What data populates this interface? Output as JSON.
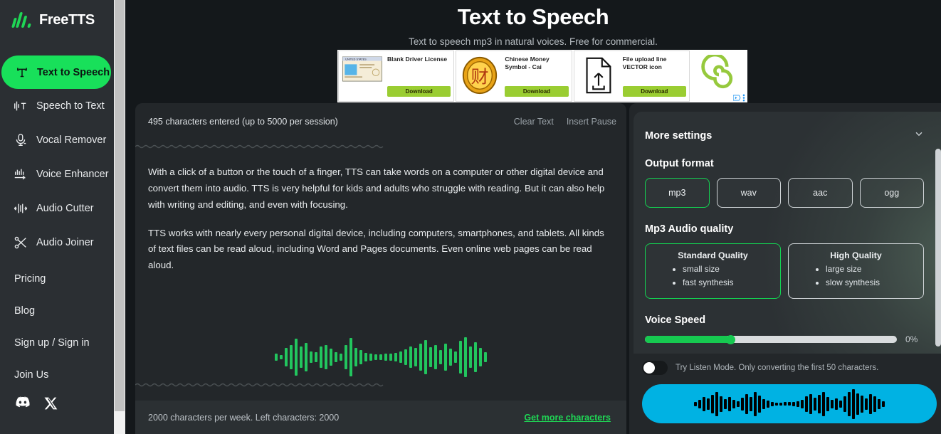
{
  "sidebar": {
    "brand": "FreeTTS",
    "brand_accent": "#1fd655",
    "items": [
      {
        "label": "Text to Speech",
        "icon": "text-to-speech-icon",
        "active": true
      },
      {
        "label": "Speech to Text",
        "icon": "speech-to-text-icon",
        "active": false
      },
      {
        "label": "Vocal Remover",
        "icon": "microphone-icon",
        "active": false
      },
      {
        "label": "Voice Enhancer",
        "icon": "voice-enhancer-icon",
        "active": false
      },
      {
        "label": "Audio Cutter",
        "icon": "audio-cutter-icon",
        "active": false
      },
      {
        "label": "Audio Joiner",
        "icon": "scissors-icon",
        "active": false
      }
    ],
    "links": [
      {
        "label": "Pricing"
      },
      {
        "label": "Blog"
      },
      {
        "label": "Sign up / Sign in"
      },
      {
        "label": "Join Us"
      }
    ],
    "socials": [
      {
        "name": "discord-icon"
      },
      {
        "name": "x-twitter-icon"
      }
    ]
  },
  "header": {
    "title": "Text to Speech",
    "subtitle": "Text to speech mp3 in natural voices. Free for commercial."
  },
  "ad": {
    "cards": [
      {
        "title": "Blank Driver License",
        "button": "Download",
        "thumb": "id-card-thumb"
      },
      {
        "title": "Chinese Money Symbol - Cai",
        "button": "Download",
        "thumb": "chinese-coin-thumb"
      },
      {
        "title": "File upload line VECTOR icon",
        "button": "Download",
        "thumb": "file-upload-thumb"
      }
    ],
    "brand_logo": "green-spiral-logo",
    "adchoices": "adchoices-icon"
  },
  "editor": {
    "char_count": "495 characters entered (up to 5000 per session)",
    "clear_text": "Clear Text",
    "insert_pause": "Insert Pause",
    "paragraphs": [
      "With a click of a button or the touch of a finger, TTS can take words on a computer or other digital device and convert them into audio. TTS is very helpful for kids and adults who struggle with reading. But it can also help with writing and editing, and even with focusing.",
      "TTS works with nearly every personal digital device, including computers, smartphones, and tablets. All kinds of text files can be read aloud, including Word and Pages documents. Even online web pages can be read aloud."
    ],
    "footer_text": "2000 characters per week. Left characters: 2000",
    "footer_link": "Get more characters",
    "waveform_color": "#22c55e"
  },
  "settings": {
    "title": "More settings",
    "collapse_icon": "chevron-down-icon",
    "output_format": {
      "label": "Output format",
      "options": [
        {
          "label": "mp3",
          "selected": true
        },
        {
          "label": "wav",
          "selected": false
        },
        {
          "label": "aac",
          "selected": false
        },
        {
          "label": "ogg",
          "selected": false
        }
      ]
    },
    "audio_quality": {
      "label": "Mp3 Audio quality",
      "options": [
        {
          "title": "Standard Quality",
          "bullets": [
            "small size",
            "fast synthesis"
          ],
          "selected": true
        },
        {
          "title": "High Quality",
          "bullets": [
            "large size",
            "slow synthesis"
          ],
          "selected": false
        }
      ]
    },
    "voice_speed": {
      "label": "Voice Speed",
      "value": "0%",
      "handle_percent": 34
    },
    "listen_mode": {
      "label": "Try Listen Mode. Only converting the first 50 characters.",
      "enabled": false
    },
    "convert_button": {
      "name": "convert-waveform-button",
      "color": "#00b2e3"
    },
    "accent_selected": "#13d352"
  }
}
